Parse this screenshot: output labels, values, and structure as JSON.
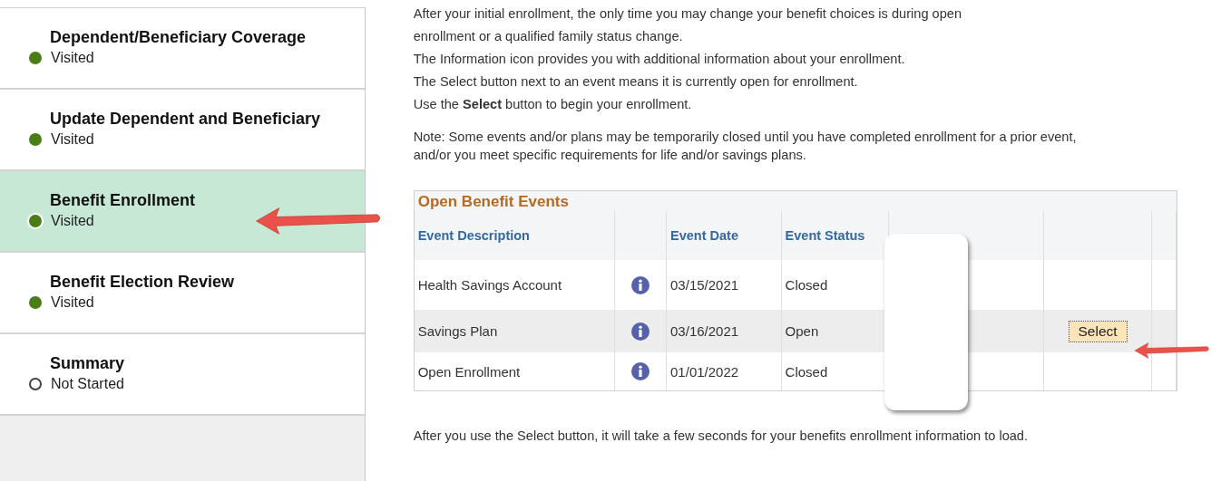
{
  "sidebar": {
    "items": [
      {
        "title": "Dependent/Beneficiary Coverage",
        "status": "Visited",
        "kind": "visited",
        "selected": false
      },
      {
        "title": "Update Dependent and Beneficiary",
        "status": "Visited",
        "kind": "visited",
        "selected": false
      },
      {
        "title": "Benefit Enrollment",
        "status": "Visited",
        "kind": "visited",
        "selected": true
      },
      {
        "title": "Benefit Election Review",
        "status": "Visited",
        "kind": "visited",
        "selected": false
      },
      {
        "title": "Summary",
        "status": "Not Started",
        "kind": "not_started",
        "selected": false
      }
    ]
  },
  "intro": {
    "lines": [
      "After your initial enrollment, the only time you may change your benefit choices is during open",
      "enrollment or a qualified family status change.",
      "The Information icon provides you with additional information about your enrollment.",
      "The Select button next to an event means it is currently open for enrollment.",
      "Use the **Select** button to begin your enrollment."
    ],
    "note": "Note: Some events and/or plans may be temporarily closed until you have completed enrollment for a prior event, and/or you meet specific requirements for life and/or savings plans."
  },
  "events_table": {
    "title": "Open Benefit Events",
    "columns": [
      "Event Description",
      "Event Date",
      "Event Status"
    ],
    "rows": [
      {
        "description": "Health Savings Account",
        "date": "03/15/2021",
        "status": "Closed",
        "highlighted": false
      },
      {
        "description": "Savings Plan",
        "date": "03/16/2021",
        "status": "Open",
        "highlighted": true,
        "button": "Select"
      },
      {
        "description": "Open Enrollment",
        "date": "01/01/2022",
        "status": "Closed",
        "highlighted": false
      }
    ]
  },
  "footer_note": "After you use the Select button, it will take a few seconds for your benefits enrollment information to load."
}
